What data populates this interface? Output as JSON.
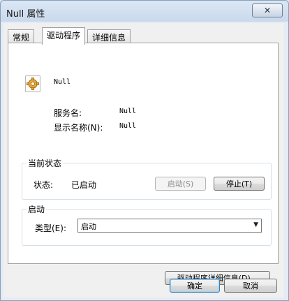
{
  "window": {
    "title": "Null 属性",
    "close_icon": "close-icon"
  },
  "tabs": [
    {
      "label": "常规",
      "active": false
    },
    {
      "label": "驱动程序",
      "active": true
    },
    {
      "label": "详细信息",
      "active": false
    }
  ],
  "driver": {
    "icon": "gear-icon",
    "name": "Null",
    "service_name_label": "服务名:",
    "service_name_value": "Null",
    "display_name_label": "显示名称(N):",
    "display_name_value": "Null"
  },
  "current_status": {
    "group_title": "当前状态",
    "status_label": "状态:",
    "status_value": "已启动",
    "start_button": "启动(S)",
    "stop_button": "停止(T)"
  },
  "startup": {
    "group_title": "启动",
    "type_label": "类型(E):",
    "type_value": "启动"
  },
  "driver_details_button": "驱动程序详细信息(D)...",
  "footer": {
    "ok_button": "确定",
    "cancel_button": "取消"
  }
}
